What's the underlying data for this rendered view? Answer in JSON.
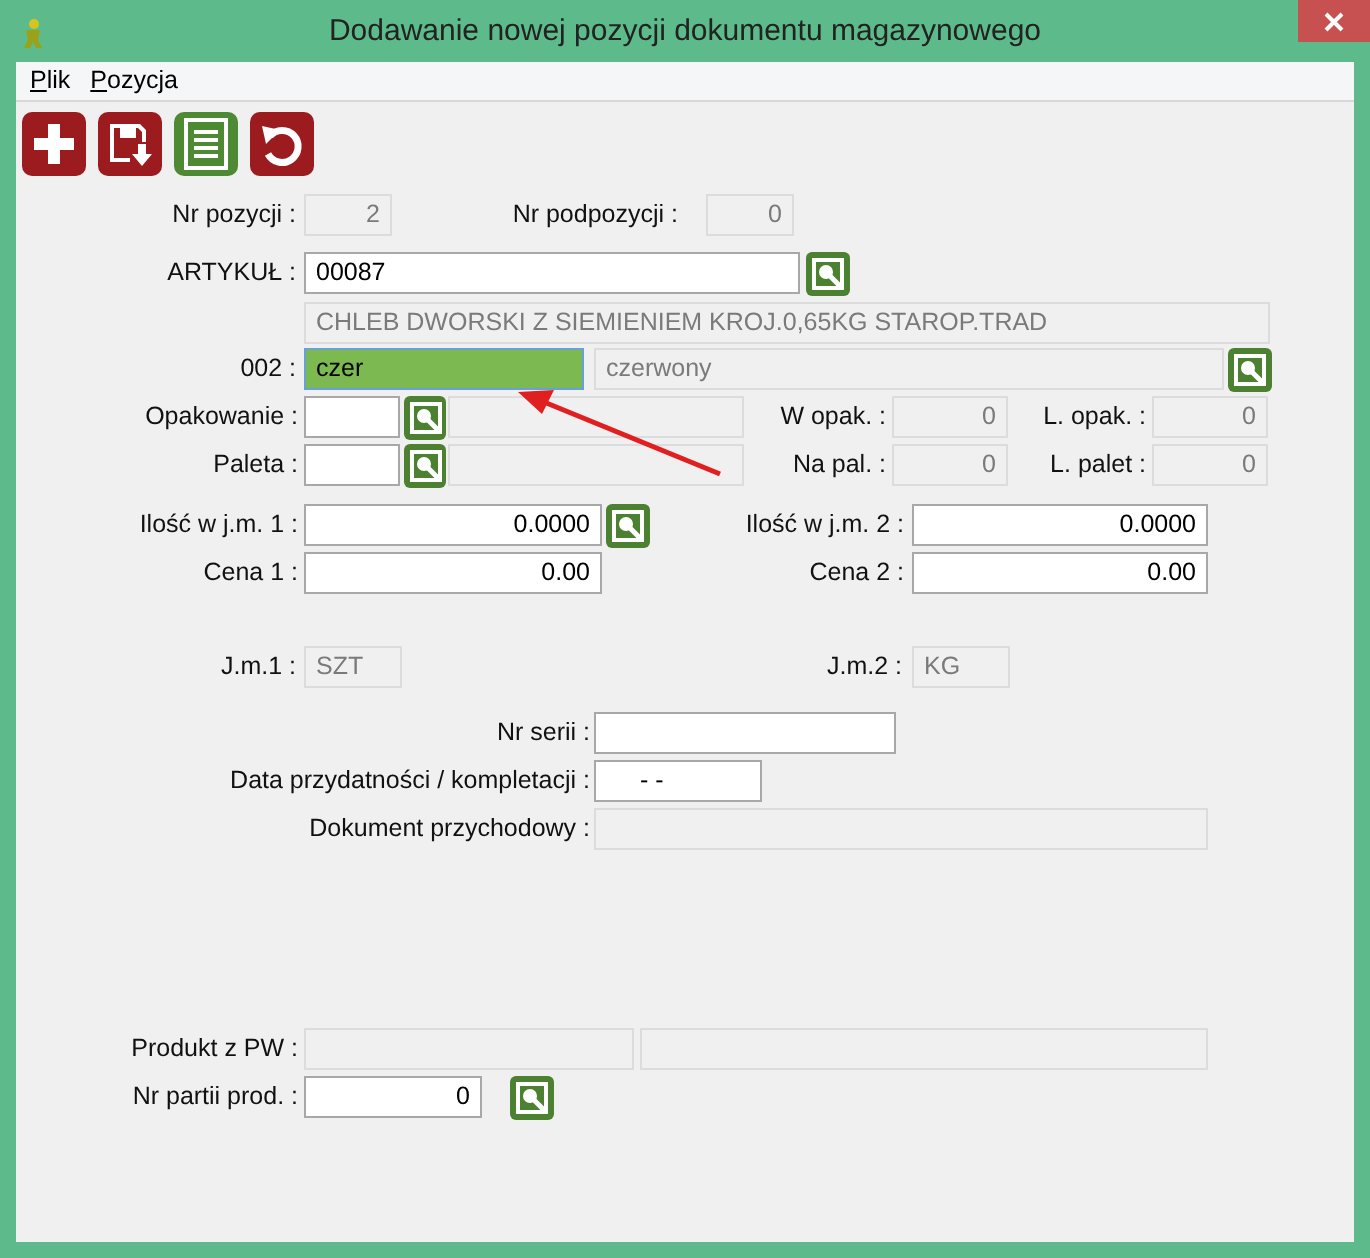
{
  "window": {
    "title": "Dodawanie nowej pozycji dokumentu magazynowego"
  },
  "menu": [
    {
      "label": "Plik"
    },
    {
      "label": "Pozycja"
    }
  ],
  "toolbar": [
    {
      "kind": "add"
    },
    {
      "kind": "save"
    },
    {
      "kind": "document"
    },
    {
      "kind": "undo"
    }
  ],
  "rows": [
    {
      "items": [
        {
          "kind": "label",
          "text": "Nr pozycji :"
        },
        {
          "kind": "field",
          "value": "2",
          "disabled": true,
          "focused": false
        },
        {
          "kind": "label",
          "text": "Nr podpozycji :"
        },
        {
          "kind": "field",
          "value": "0",
          "disabled": true,
          "focused": false
        }
      ]
    },
    {
      "items": [
        {
          "kind": "label",
          "text": "ARTYKUŁ :"
        },
        {
          "kind": "field",
          "value": "00087",
          "disabled": false,
          "focused": false
        },
        {
          "kind": "lookup"
        }
      ]
    },
    {
      "items": [
        {
          "kind": "field",
          "value": "CHLEB DWORSKI Z SIEMIENIEM KROJ.0,65KG STAROP.TRAD",
          "disabled": true,
          "focused": false
        }
      ]
    },
    {
      "items": [
        {
          "kind": "label",
          "text": "002 :"
        },
        {
          "kind": "field",
          "value": "czer",
          "disabled": false,
          "focused": true
        },
        {
          "kind": "field",
          "value": "czerwony",
          "disabled": true,
          "focused": false
        },
        {
          "kind": "lookup"
        }
      ]
    },
    {
      "items": [
        {
          "kind": "label",
          "text": "Opakowanie :"
        },
        {
          "kind": "field",
          "disabled": false,
          "focused": false
        },
        {
          "kind": "lookup"
        },
        {
          "kind": "field",
          "disabled": true,
          "focused": false
        },
        {
          "kind": "label",
          "text": "W opak. :"
        },
        {
          "kind": "field",
          "value": "0",
          "disabled": true,
          "focused": false
        },
        {
          "kind": "label",
          "text": "L. opak. :"
        },
        {
          "kind": "field",
          "value": "0",
          "disabled": true,
          "focused": false
        }
      ]
    },
    {
      "items": [
        {
          "kind": "label",
          "text": "Paleta :"
        },
        {
          "kind": "field",
          "disabled": false,
          "focused": false
        },
        {
          "kind": "lookup"
        },
        {
          "kind": "field",
          "disabled": true,
          "focused": false
        },
        {
          "kind": "label",
          "text": "Na pal. :"
        },
        {
          "kind": "field",
          "value": "0",
          "disabled": true,
          "focused": false
        },
        {
          "kind": "label",
          "text": "L. palet :"
        },
        {
          "kind": "field",
          "value": "0",
          "disabled": true,
          "focused": false
        }
      ]
    },
    {
      "items": [
        {
          "kind": "label",
          "text": "Ilość w j.m. 1 :"
        },
        {
          "kind": "field",
          "value": "0.0000",
          "disabled": false,
          "focused": false
        },
        {
          "kind": "lookup"
        },
        {
          "kind": "label",
          "text": "Ilość w j.m. 2 :"
        },
        {
          "kind": "field",
          "value": "0.0000",
          "disabled": false,
          "focused": false
        }
      ]
    },
    {
      "items": [
        {
          "kind": "label",
          "text": "Cena 1 :"
        },
        {
          "kind": "field",
          "value": "0.00",
          "disabled": false,
          "focused": false
        },
        {
          "kind": "label",
          "text": "Cena 2 :"
        },
        {
          "kind": "field",
          "value": "0.00",
          "disabled": false,
          "focused": false
        }
      ]
    },
    {
      "items": [
        {
          "kind": "label",
          "text": "J.m.1 :"
        },
        {
          "kind": "field",
          "value": "SZT",
          "disabled": true,
          "focused": false
        },
        {
          "kind": "label",
          "text": "J.m.2 :"
        },
        {
          "kind": "field",
          "value": "KG",
          "disabled": true,
          "focused": false
        }
      ]
    },
    {
      "items": [
        {
          "kind": "label",
          "text": "Nr serii :"
        },
        {
          "kind": "field",
          "disabled": false,
          "focused": false
        }
      ]
    },
    {
      "items": [
        {
          "kind": "label",
          "text": "Data przydatności / kompletacji :"
        },
        {
          "kind": "field",
          "value": "-  -",
          "disabled": false,
          "focused": false
        }
      ]
    },
    {
      "items": [
        {
          "kind": "label",
          "text": "Dokument przychodowy :"
        },
        {
          "kind": "field",
          "disabled": true,
          "focused": false
        }
      ]
    },
    {
      "items": [
        {
          "kind": "label",
          "text": "Produkt z PW :"
        },
        {
          "kind": "field",
          "disabled": true,
          "focused": false
        },
        {
          "kind": "field",
          "disabled": true,
          "focused": false
        }
      ]
    },
    {
      "items": [
        {
          "kind": "label",
          "text": "Nr partii prod. :"
        },
        {
          "kind": "field",
          "value": "0",
          "disabled": false,
          "focused": false
        },
        {
          "kind": "lookup"
        }
      ]
    }
  ]
}
